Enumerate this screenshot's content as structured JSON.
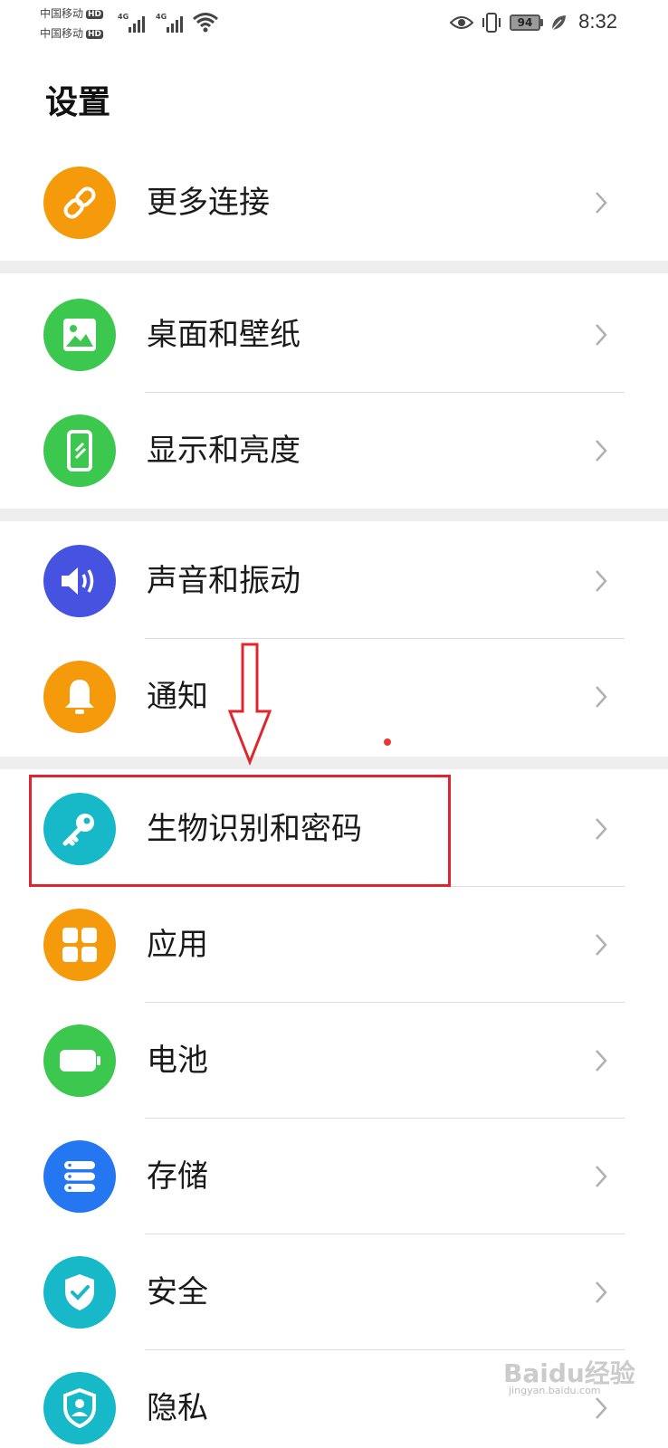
{
  "status_bar": {
    "carrier1": "中国移动",
    "carrier2": "中国移动",
    "hd": "HD",
    "net1": "4G",
    "net2": "4G",
    "battery": "94",
    "time": "8:32",
    "icons": [
      "signal-icon",
      "wifi-icon",
      "eye-icon",
      "vibrate-icon",
      "battery-icon",
      "leaf-icon"
    ]
  },
  "title": "设置",
  "groups": [
    {
      "items": [
        {
          "label": "更多连接",
          "icon": "link-icon",
          "color": "#F59A0B"
        }
      ]
    },
    {
      "items": [
        {
          "label": "桌面和壁纸",
          "icon": "image-icon",
          "color": "#3CC84F"
        },
        {
          "label": "显示和亮度",
          "icon": "phone-display-icon",
          "color": "#3CC84F"
        }
      ]
    },
    {
      "items": [
        {
          "label": "声音和振动",
          "icon": "speaker-icon",
          "color": "#4553E0"
        },
        {
          "label": "通知",
          "icon": "bell-icon",
          "color": "#F59A0B"
        }
      ]
    },
    {
      "items": [
        {
          "label": "生物识别和密码",
          "icon": "key-icon",
          "color": "#17B8C8"
        },
        {
          "label": "应用",
          "icon": "apps-grid-icon",
          "color": "#F59A0B"
        },
        {
          "label": "电池",
          "icon": "battery-icon",
          "color": "#3CC84F"
        },
        {
          "label": "存储",
          "icon": "storage-icon",
          "color": "#2477F0"
        },
        {
          "label": "安全",
          "icon": "shield-check-icon",
          "color": "#17B8C8"
        },
        {
          "label": "隐私",
          "icon": "privacy-icon",
          "color": "#17B8C8"
        }
      ]
    }
  ],
  "annotation": {
    "color": "#E0262C"
  },
  "watermark": {
    "text": "Baidu经验",
    "sub": "jingyan.baidu.com"
  }
}
